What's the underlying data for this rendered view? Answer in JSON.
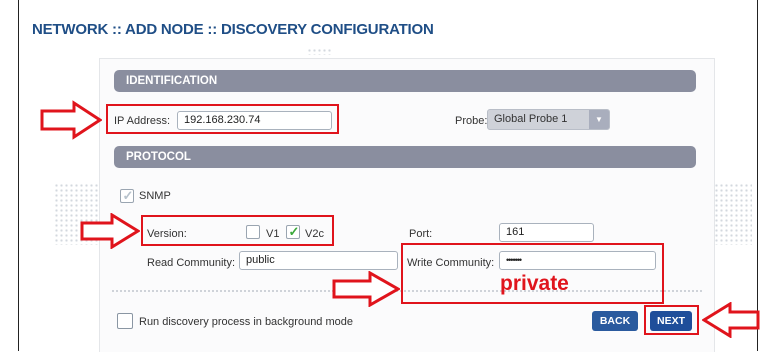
{
  "breadcrumb": "NETWORK :: ADD NODE :: DISCOVERY CONFIGURATION",
  "identification": {
    "section_title": "IDENTIFICATION",
    "ip_label": "IP Address:",
    "ip_value": "192.168.230.74",
    "probe_label": "Probe:",
    "probe_value": "Global Probe 1"
  },
  "protocol": {
    "section_title": "PROTOCOL",
    "snmp_label": "SNMP",
    "snmp_checked": true,
    "version_label": "Version:",
    "v1_label": "V1",
    "v1_checked": false,
    "v2c_label": "V2c",
    "v2c_checked": true,
    "port_label": "Port:",
    "port_value": "161",
    "read_community_label": "Read Community:",
    "read_community_value": "public",
    "write_community_label": "Write Community:",
    "write_community_value": "•••••••"
  },
  "background_mode": {
    "label": "Run discovery process in background mode",
    "checked": false
  },
  "buttons": {
    "back": "BACK",
    "next": "NEXT"
  },
  "annotation": {
    "private_text": "private"
  },
  "colors": {
    "title": "#1f4e86",
    "section_bar": "#8a8e9f",
    "button": "#2a5a9e",
    "annotation_red": "#e0141c",
    "check_green": "#3aa83a"
  }
}
